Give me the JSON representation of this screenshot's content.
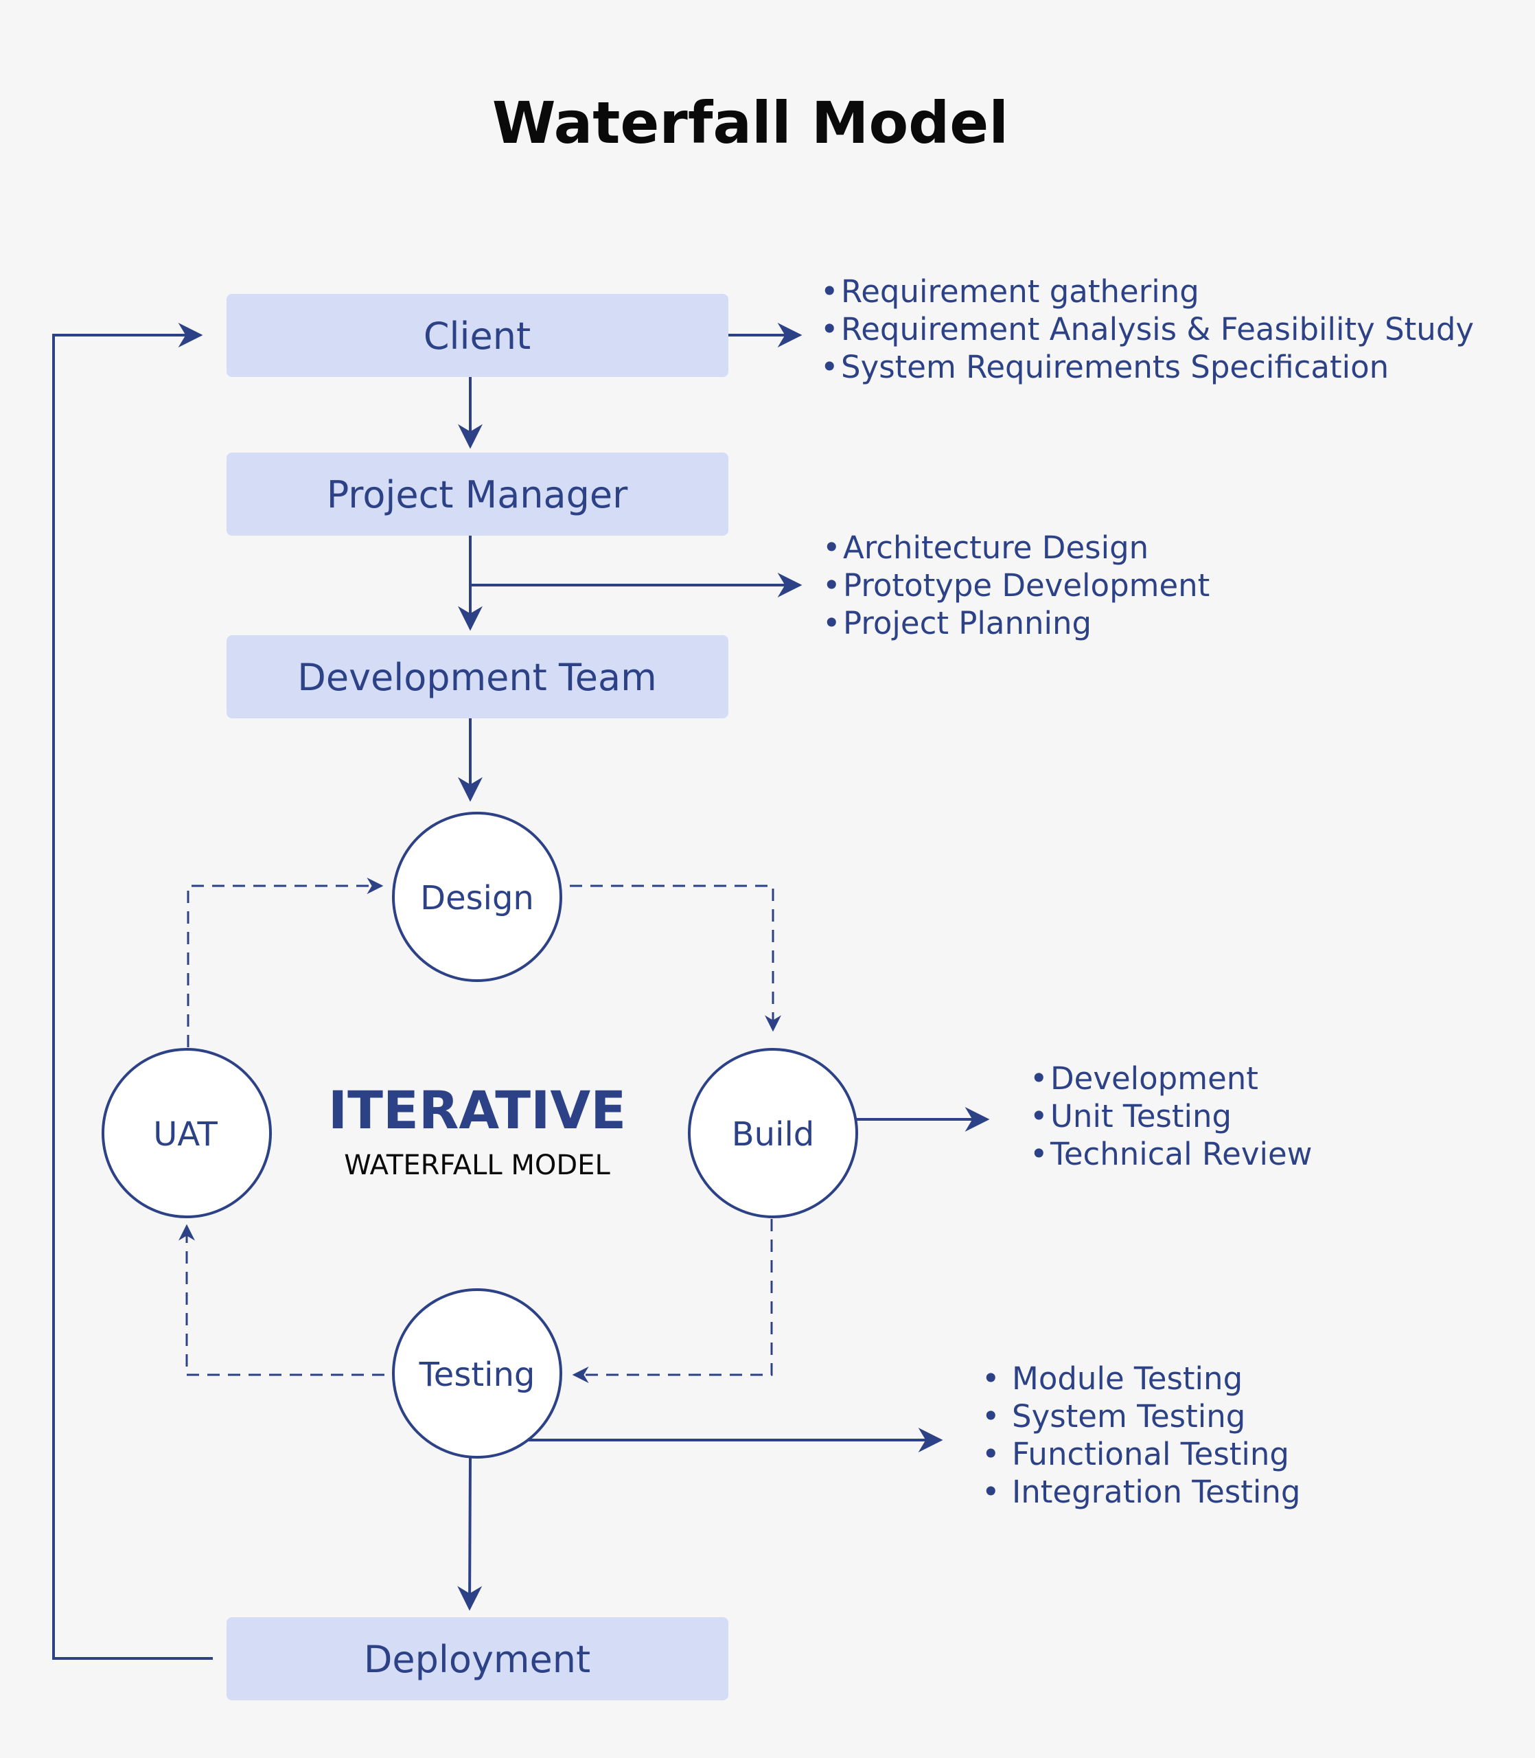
{
  "title": "Waterfall Model",
  "colors": {
    "background": "#f6f6f7",
    "box_fill": "#d4ddf5",
    "accent": "#2d4286",
    "title": "#0a0a0a"
  },
  "stages": {
    "client": "Client",
    "project_manager": "Project Manager",
    "development_team": "Development Team",
    "deployment": "Deployment"
  },
  "iterative_cycle": {
    "heading": "ITERATIVE",
    "subheading": "WATERFALL MODEL",
    "nodes": {
      "design": "Design",
      "build": "Build",
      "testing": "Testing",
      "uat": "UAT"
    }
  },
  "notes": {
    "client": [
      "Requirement gathering",
      "Requirement Analysis & Feasibility Study",
      "System Requirements Specification"
    ],
    "project_manager": [
      "Architecture Design",
      "Prototype Development",
      "Project Planning"
    ],
    "build": [
      "Development",
      "Unit Testing",
      "Technical Review"
    ],
    "testing": [
      "Module Testing",
      "System Testing",
      "Functional Testing",
      "Integration Testing"
    ]
  },
  "bullet_char": "•"
}
